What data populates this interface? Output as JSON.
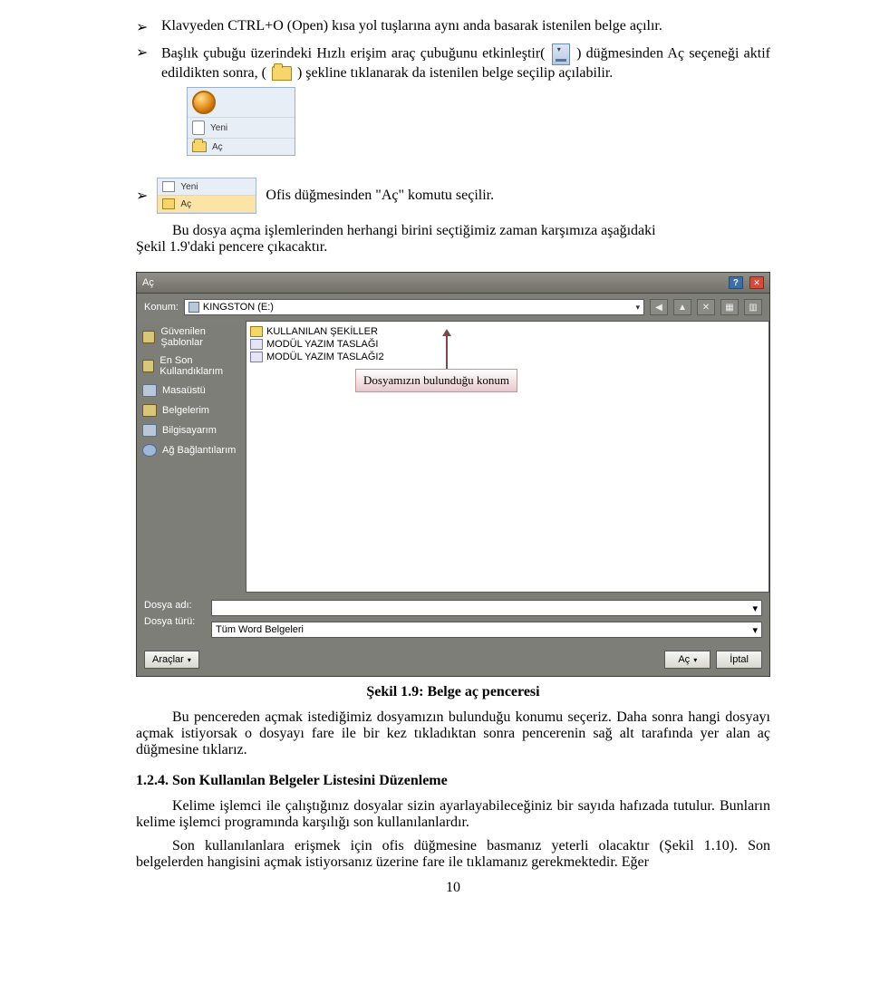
{
  "bullets": {
    "b1": "Klavyeden CTRL+O (Open) kısa yol tuşlarına aynı anda basarak istenilen belge açılır.",
    "b2a": "Başlık  çubuğu  üzerindeki  Hızlı  erişim  araç  çubuğunu  etkinleştir(",
    "b2b": ") düğmesinden Aç seçeneği aktif edildikten sonra, (",
    "b2c": ")  şekline tıklanarak da istenilen  belge seçilip açılabilir.",
    "b3": "Ofis düğmesinden \"Aç\" komutu seçilir."
  },
  "mini_office": {
    "yeni": "Yeni",
    "ac": "Aç"
  },
  "para_after_bullet3a": "Bu dosya açma işlemlerinden herhangi birini seçtiğimiz zaman karşımıza aşağıdaki",
  "para_after_bullet3b": "Şekil 1.9'daki pencere çıkacaktır.",
  "dialog": {
    "title": "Aç",
    "konum_label": "Konum:",
    "konum_value": "KINGSTON (E:)",
    "side": {
      "guvenilen": "Güvenilen Şablonlar",
      "enson": "En Son Kullandıklarım",
      "masaustu": "Masaüstü",
      "belgelerim": "Belgelerim",
      "bilgisayarim": "Bilgisayarım",
      "ag": "Ağ Bağlantılarım"
    },
    "files": {
      "f1": "KULLANILAN ŞEKİLLER",
      "f2": "MODÜL YAZIM TASLAĞI",
      "f3": "MODÜL YAZIM TASLAĞI2"
    },
    "annotation": "Dosyamızın bulunduğu konum",
    "dosya_adi_label": "Dosya adı:",
    "dosya_turu_label": "Dosya türü:",
    "dosya_turu_value": "Tüm Word Belgeleri",
    "araclar_btn": "Araçlar",
    "ac_btn": "Aç",
    "iptal_btn": "İptal"
  },
  "caption": "Şekil 1.9: Belge aç penceresi",
  "para2": "Bu pencereden açmak istediğimiz dosyamızın bulunduğu konumu seçeriz. Daha sonra hangi dosyayı açmak istiyorsak o dosyayı fare ile bir kez tıkladıktan sonra pencerenin sağ alt tarafında yer alan aç düğmesine tıklarız.",
  "heading": "1.2.4. Son Kullanılan Belgeler Listesini Düzenleme",
  "para3": "Kelime işlemci ile çalıştığınız dosyalar sizin ayarlayabileceğiniz bir sayıda hafızada tutulur. Bunların kelime işlemci programında karşılığı son kullanılanlardır.",
  "para4": "Son kullanılanlara erişmek için ofis düğmesine basmanız yeterli olacaktır (Şekil 1.10). Son belgelerden hangisini açmak istiyorsanız üzerine fare ile tıklamanız gerekmektedir. Eğer",
  "page_number": "10"
}
